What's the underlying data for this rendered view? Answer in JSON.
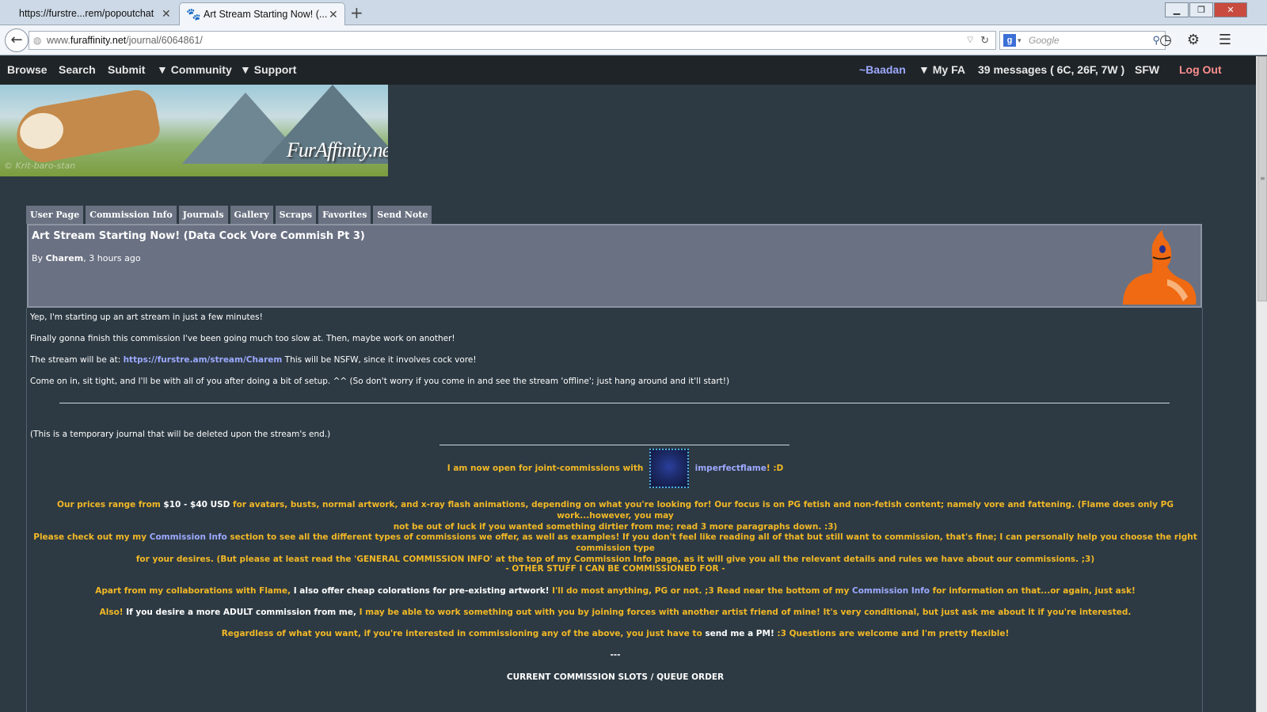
{
  "browser": {
    "tabs": [
      {
        "title": "https://furstre...rem/popoutchat"
      },
      {
        "title": "Art Stream Starting Now! (..."
      }
    ],
    "url_prefix": "www.",
    "url_domain": "furaffinity.net",
    "url_path": "/journal/6064861/",
    "search_placeholder": "Google",
    "search_engine_letter": "g"
  },
  "sitenav": {
    "left": [
      "Browse",
      "Search",
      "Submit",
      "▼ Community",
      "▼ Support"
    ],
    "user": "~Baadan",
    "myfa": "▼ My FA",
    "messages": "39 messages ( 6C, 26F, 7W )",
    "sfw": "SFW",
    "logout": "Log Out"
  },
  "banner": {
    "logo": "FurAffinity.net",
    "signature": "© Krit-baro-stan"
  },
  "profile_tabs": [
    "User Page",
    "Commission Info",
    "Journals",
    "Gallery",
    "Scraps",
    "Favorites",
    "Send Note"
  ],
  "journal": {
    "title": "Art Stream Starting Now! (Data Cock Vore Commish Pt 3)",
    "by_prefix": "By",
    "author": "Charem",
    "time": ", 3 hours ago"
  },
  "body": {
    "p1": "Yep, I'm starting up an art stream in just a few minutes!",
    "p2": "Finally gonna finish this commission I've been going much too slow at. Then, maybe work on another!",
    "p3_pre": "The stream will be at: ",
    "p3_link": "https://furstre.am/stream/Charem",
    "p3_post": " This will be NSFW, since it involves cock vore!",
    "p4": "Come on in, sit tight, and I'll be with all of you after doing a bit of setup. ^^ (So don't worry if you come in and see the stream 'offline'; just hang around and it'll start!)",
    "p5": "(This is a temporary journal that will be deleted upon the stream's end.)",
    "joint_pre": "I am now open for joint-commissions with",
    "joint_link": "imperfectflame",
    "joint_post": "! :D",
    "prices_a": "Our prices range from ",
    "prices_b": "$10 - $40 USD",
    "prices_c": " for avatars, busts, normal artwork, and x-ray flash animations, depending on what you're looking for! Our focus is on PG fetish and non-fetish content; namely vore and fattening. (Flame does only PG work...however, you may",
    "prices_d": "not be out of luck if you wanted something dirtier from me; read 3 more paragraphs down. :3)",
    "check_a": "Please check out my my ",
    "check_link": "Commission Info",
    "check_b": " section to see all the different types of commissions we offer, as well as examples! If you don't feel like reading all of that but still want to commission, that's fine; I can personally help you choose the right commission type",
    "check_c": "for your desires. (But please at least read the 'GENERAL COMMISSION INFO' at the top of my Commission Info page, as it will give you all the relevant details and rules we have about our commissions. ;3)",
    "other": "- OTHER STUFF I CAN BE COMMISSIONED FOR -",
    "apart_a": "Apart from my collaborations with Flame, ",
    "apart_b": "I also offer cheap colorations for pre-existing artwork!",
    "apart_c": " I'll do most anything, PG or not. ;3 Read near the bottom of my ",
    "apart_link": "Commission Info",
    "apart_d": " for information on that...or again, just ask!",
    "also_a": "Also! ",
    "also_b": "If you desire a more ADULT commission from me,",
    "also_c": " I may be able to work something out with you by joining forces with another artist friend of mine! It's very conditional, but just ask me about it if you're interested.",
    "regard_a": "Regardless of what you want, if you're interested in commissioning any of the above, you just have to ",
    "regard_b": "send me a PM!",
    "regard_c": " :3 Questions are welcome and I'm pretty flexible!",
    "sep": "---",
    "slots": "CURRENT COMMISSION SLOTS / QUEUE ORDER"
  },
  "colors": {
    "site_bg": "#2d3a43",
    "nav_bg": "#1f2428",
    "highlight_text": "#f2b826",
    "link": "#9da9ff",
    "tab_bg": "#6a7282"
  }
}
